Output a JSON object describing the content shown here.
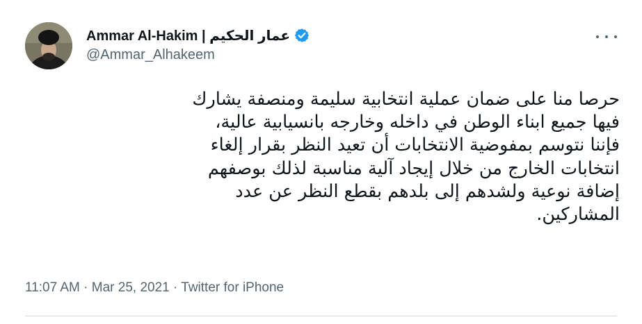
{
  "tweet": {
    "display_name": "Ammar Al-Hakim | عمار الحكيم",
    "handle": "@Ammar_Alhakeem",
    "verified": true,
    "text_lines": [
      "حرصا منا على ضمان عملية انتخابية سليمة ومنصفة يشارك",
      "فيها جميع ابناء الوطن في داخله وخارجه بانسيابية عالية،",
      "فإننا نتوسم بمفوضية الانتخابات أن تعيد النظر بقرار إلغاء",
      "انتخابات  الخارج من خلال إيجاد آلية مناسبة لذلك بوصفهم",
      "إضافة نوعية ولشدهم إلى بلدهم بقطع النظر عن عدد",
      "المشاركين."
    ],
    "time": "11:07 AM",
    "date": "Mar 25, 2021",
    "source": "Twitter for iPhone",
    "separator": "·"
  },
  "icons": {
    "verified": "verified-badge-icon",
    "more": "more-options-icon",
    "avatar": "profile-photo"
  },
  "colors": {
    "verified_blue": "#1d9bf0",
    "secondary_text": "#536471",
    "primary_text": "#0f1419",
    "divider": "#cfd9de"
  }
}
